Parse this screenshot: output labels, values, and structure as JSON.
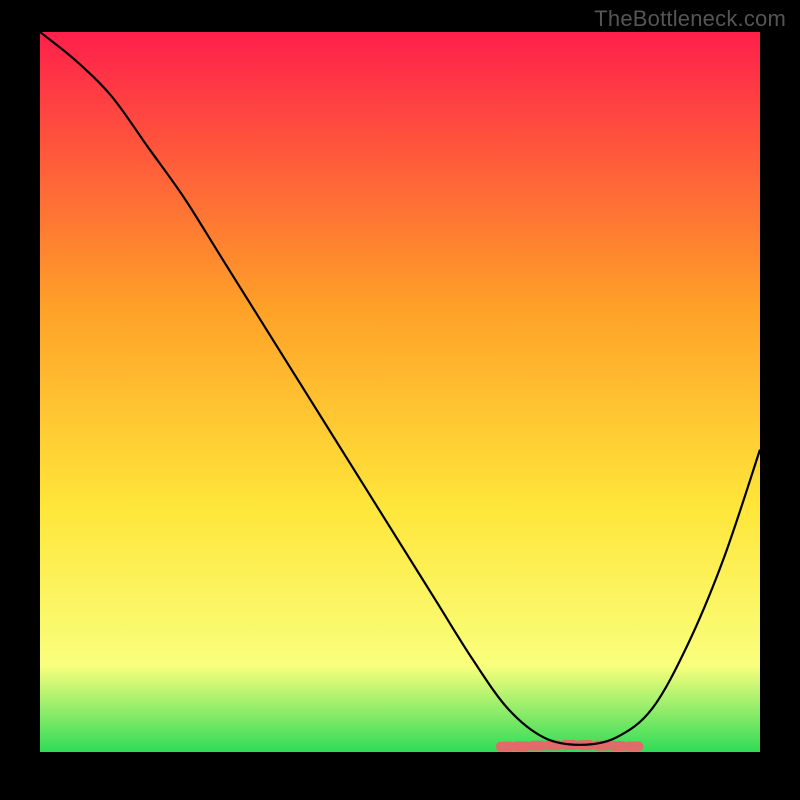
{
  "watermark": "TheBottleneck.com",
  "chart_data": {
    "type": "line",
    "title": "",
    "xlabel": "",
    "ylabel": "",
    "xlim": [
      0,
      100
    ],
    "ylim": [
      0,
      100
    ],
    "grid": false,
    "legend": false,
    "series": [
      {
        "name": "curve",
        "x": [
          0,
          5,
          10,
          15,
          20,
          25,
          30,
          35,
          40,
          45,
          50,
          55,
          60,
          65,
          70,
          75,
          80,
          85,
          90,
          95,
          100
        ],
        "values": [
          100,
          96,
          91,
          84,
          77,
          69,
          61,
          53,
          45,
          37,
          29,
          21,
          13,
          6,
          2,
          1,
          2,
          6,
          15,
          27,
          42
        ]
      }
    ],
    "highlight": {
      "name": "accent",
      "x_start": 64,
      "x_end": 84,
      "y": 1
    },
    "colors": {
      "gradient_top": "#ff1f4b",
      "gradient_mid1": "#ffa028",
      "gradient_mid2": "#ffe63a",
      "gradient_mid3": "#f9ff7d",
      "gradient_bottom": "#2fdb58",
      "line": "#000000",
      "accent": "#e26a6a",
      "background": "#000000"
    }
  }
}
